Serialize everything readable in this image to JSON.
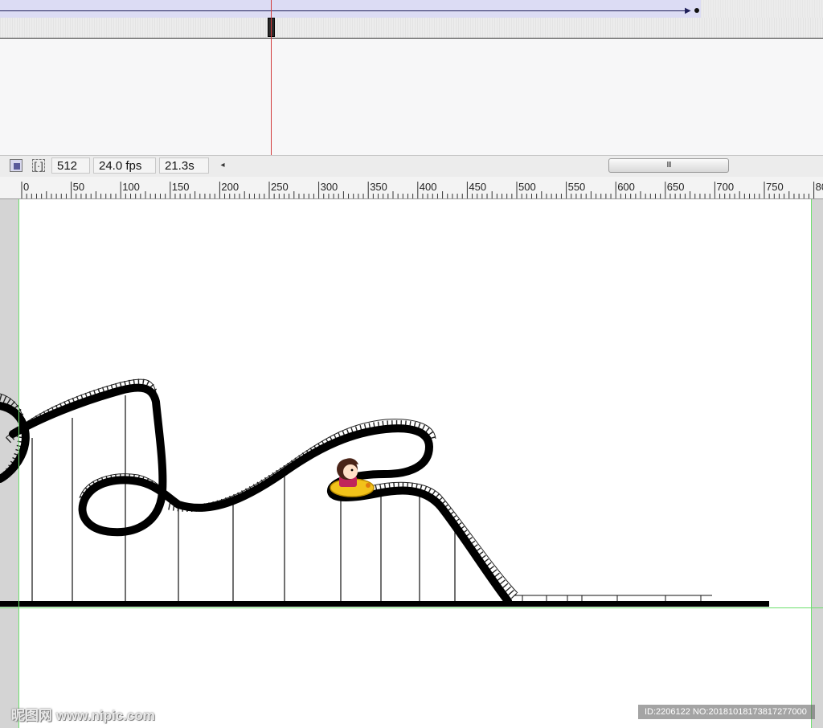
{
  "timeline": {
    "tween_color": "#1f1f5a",
    "keyframe_color": "#2a2a2a",
    "playhead_color": "#d23a3a"
  },
  "statusbar": {
    "onion_icon": "onion-skin-icon",
    "markers_icon": "edit-markers-icon",
    "markers_glyph": "[·]",
    "current_frame": "512",
    "frame_rate": "24.0 fps",
    "elapsed_time": "21.3s",
    "scroll_left_glyph": "◂",
    "scroll_thumb_grip": "III"
  },
  "ruler": {
    "labels": [
      "0",
      "50",
      "100",
      "150",
      "200",
      "250",
      "300",
      "350",
      "400",
      "450",
      "500",
      "550",
      "600",
      "650",
      "700",
      "750",
      "80"
    ]
  },
  "stage": {
    "background": "#ffffff",
    "guide_color": "#6ce06c",
    "track_color": "#000000",
    "cart_color": "#f2c21a"
  },
  "watermarks": {
    "left": "昵图网 www.nipic.com",
    "right": "ID:2206122 NO:20181018173817277000"
  }
}
